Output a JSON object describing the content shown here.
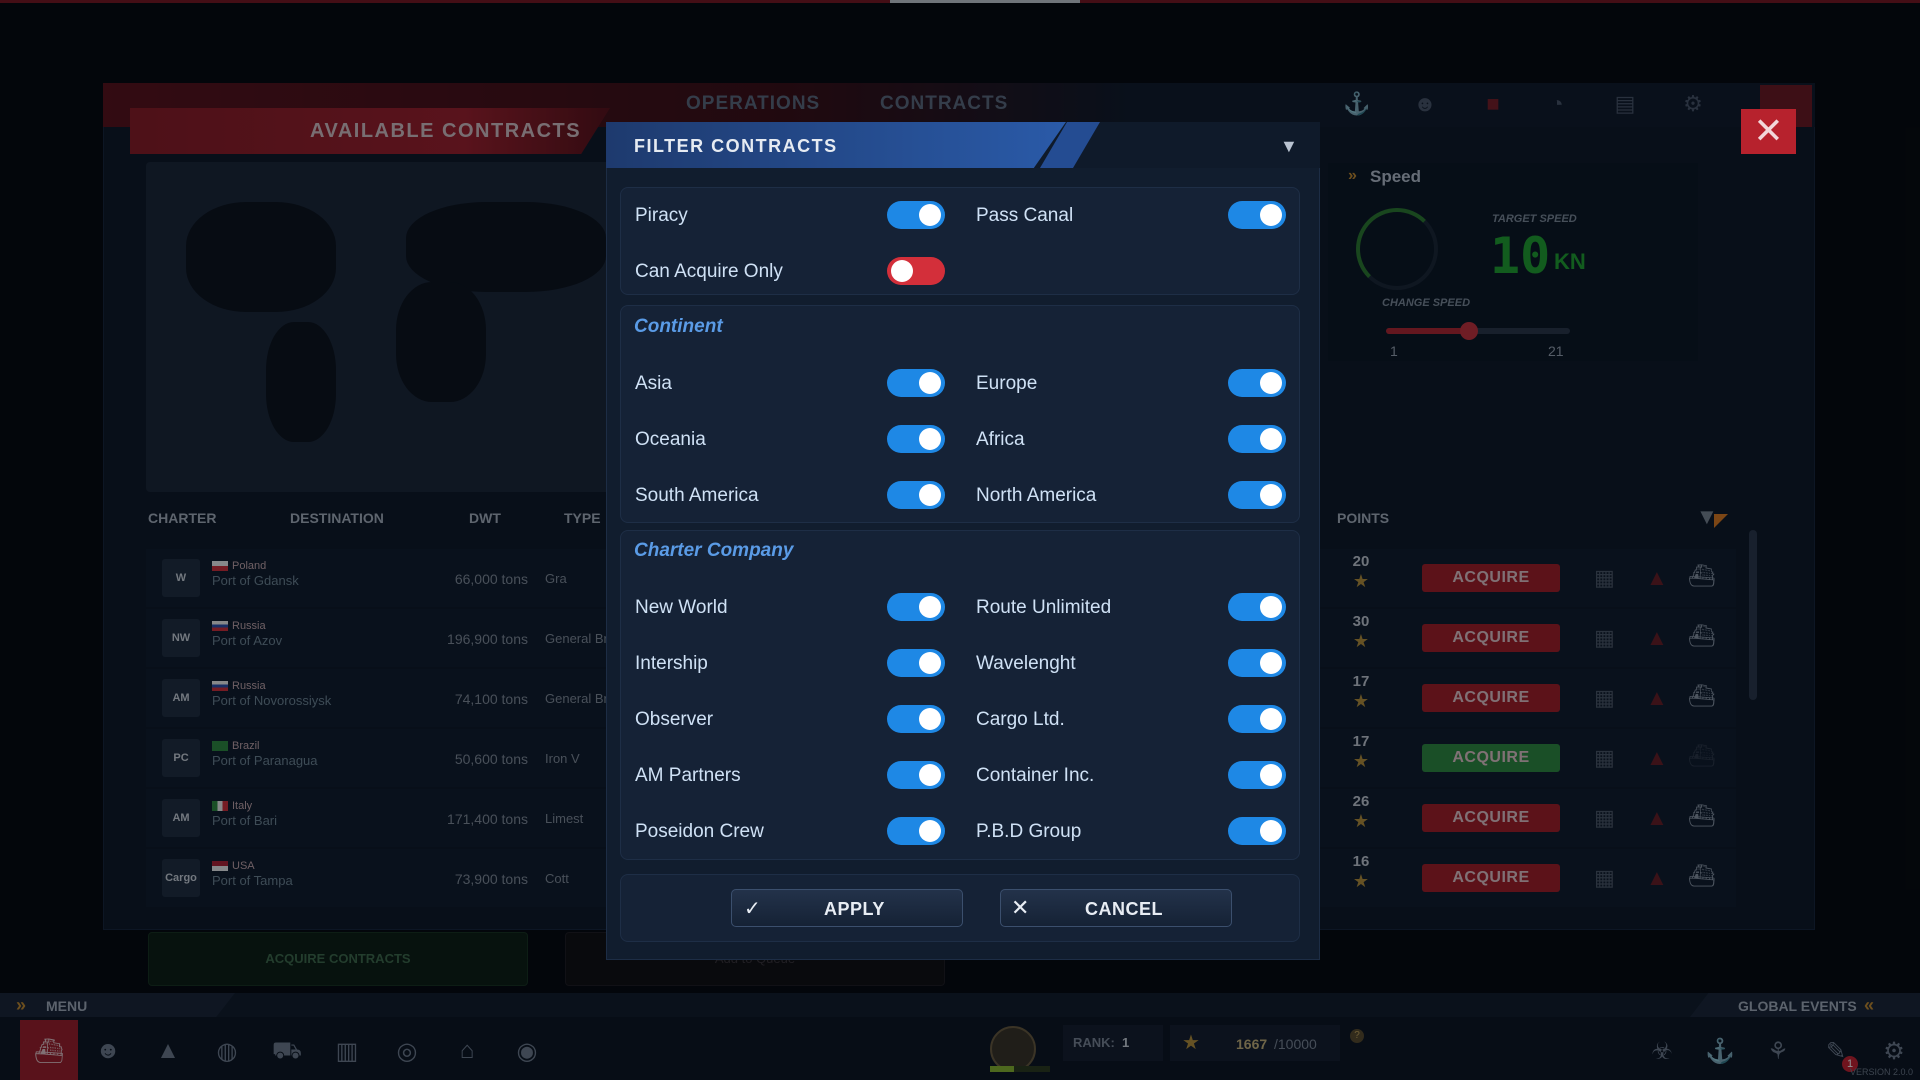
{
  "window": {
    "tabs": [
      "OPERATIONS",
      "CONTRACTS"
    ],
    "top_icons": [
      "anchor-icon",
      "crew-icon",
      "contracts-icon",
      "gauge-icon",
      "chart-icon",
      "settings-icon"
    ]
  },
  "contracts_panel": {
    "title": "AVAILABLE CONTRACTS",
    "columns": {
      "charter": "CHARTER",
      "destination": "DESTINATION",
      "dwt": "DWT",
      "type": "TYPE",
      "points": "POINTS"
    },
    "rows": [
      {
        "logo": "W",
        "country": "Poland",
        "port": "Port of Gdansk",
        "dwt": "66,000 tons",
        "type": "Gra",
        "points": "20",
        "acquire": "ACQUIRE",
        "status": "red"
      },
      {
        "logo": "NW",
        "country": "Russia",
        "port": "Port of Azov",
        "dwt": "196,900 tons",
        "type": "General Br",
        "points": "30",
        "acquire": "ACQUIRE",
        "status": "red"
      },
      {
        "logo": "AM",
        "country": "Russia",
        "port": "Port of Novorossiysk",
        "dwt": "74,100 tons",
        "type": "General Br",
        "points": "17",
        "acquire": "ACQUIRE",
        "status": "red"
      },
      {
        "logo": "PC",
        "country": "Brazil",
        "port": "Port of Paranagua",
        "dwt": "50,600 tons",
        "type": "Iron V",
        "points": "17",
        "acquire": "ACQUIRE",
        "status": "green"
      },
      {
        "logo": "AM",
        "country": "Italy",
        "port": "Port of Bari",
        "dwt": "171,400 tons",
        "type": "Limest",
        "points": "26",
        "acquire": "ACQUIRE",
        "status": "red"
      },
      {
        "logo": "Cargo",
        "country": "USA",
        "port": "Port of Tampa",
        "dwt": "73,900 tons",
        "type": "Cott",
        "points": "16",
        "acquire": "ACQUIRE",
        "status": "red"
      }
    ],
    "acquire_contracts": "ACQUIRE CONTRACTS",
    "add_to_queue": "Add to Queue"
  },
  "speed_panel": {
    "title": "Speed",
    "target_label": "TARGET SPEED",
    "target_value": "10",
    "target_unit": "KN",
    "change_label": "CHANGE SPEED",
    "min": "1",
    "max": "21",
    "slider_fraction": 0.45
  },
  "dialog": {
    "title": "FILTER CONTRACTS",
    "general": [
      {
        "label": "Piracy",
        "on": true
      },
      {
        "label": "Pass Canal",
        "on": true
      },
      {
        "label": "Can Acquire Only",
        "on": false
      }
    ],
    "continent": {
      "title": "Continent",
      "items": [
        {
          "label": "Asia",
          "on": true
        },
        {
          "label": "Europe",
          "on": true
        },
        {
          "label": "Oceania",
          "on": true
        },
        {
          "label": "Africa",
          "on": true
        },
        {
          "label": "South America",
          "on": true
        },
        {
          "label": "North America",
          "on": true
        }
      ]
    },
    "charter": {
      "title": "Charter Company",
      "items": [
        {
          "label": "New World",
          "on": true
        },
        {
          "label": "Route Unlimited",
          "on": true
        },
        {
          "label": "Intership",
          "on": true
        },
        {
          "label": "Wavelenght",
          "on": true
        },
        {
          "label": "Observer",
          "on": true
        },
        {
          "label": "Cargo Ltd.",
          "on": true
        },
        {
          "label": "AM Partners",
          "on": true
        },
        {
          "label": "Container Inc.",
          "on": true
        },
        {
          "label": "Poseidon Crew",
          "on": true
        },
        {
          "label": "P.B.D Group",
          "on": true
        }
      ]
    },
    "apply": "APPLY",
    "cancel": "CANCEL"
  },
  "bottom": {
    "menu": "MENU",
    "global_events": "GLOBAL EVENTS",
    "rank_label": "RANK:",
    "rank_value": "1",
    "xp_current": "1667",
    "xp_max": "/10000",
    "version": "VERSION 2.0.0",
    "notification_count": "1"
  },
  "colors": {
    "accent_blue": "#1e88e5",
    "toggle_off": "#d32f3a",
    "acquire_red": "#a61c26",
    "acquire_green": "#2e8b3e"
  }
}
